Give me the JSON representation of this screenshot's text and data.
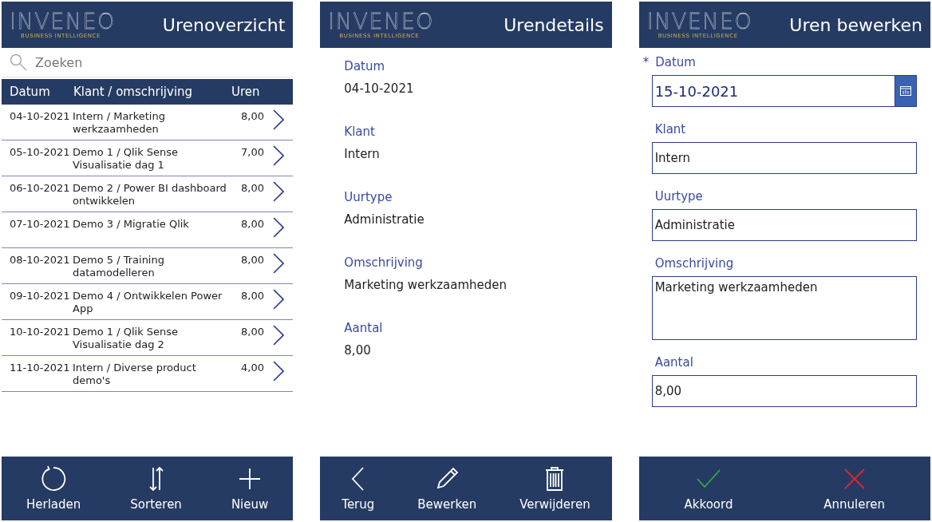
{
  "screens": [
    {
      "kind": "list",
      "logo": {
        "name": "INVENEO",
        "tagline": "BUSINESS INTELLIGENCE"
      },
      "title": "Urenoverzicht",
      "search": {
        "placeholder": "Zoeken"
      },
      "columns": [
        "Datum",
        "Klant / omschrijving",
        "Uren"
      ],
      "rows": [
        {
          "date": "04-10-2021",
          "description": "Intern / Marketing werkzaamheden",
          "hours": "8,00"
        },
        {
          "date": "05-10-2021",
          "description": "Demo 1 / Qlik Sense Visualisatie dag 1",
          "hours": "7,00"
        },
        {
          "date": "06-10-2021",
          "description": "Demo 2 / Power BI dashboard ontwikkelen",
          "hours": "8,00"
        },
        {
          "date": "07-10-2021",
          "description": "Demo 3 / Migratie Qlik",
          "hours": "8,00"
        },
        {
          "date": "08-10-2021",
          "description": "Demo 5 / Training datamodelleren",
          "hours": "8,00"
        },
        {
          "date": "09-10-2021",
          "description": "Demo 4 / Ontwikkelen Power App",
          "hours": "8,00"
        },
        {
          "date": "10-10-2021",
          "description": "Demo 1 / Qlik Sense Visualisatie dag 2",
          "hours": "8,00"
        },
        {
          "date": "11-10-2021",
          "description": "Intern / Diverse product demo's",
          "hours": "4,00"
        }
      ],
      "toolbar": [
        {
          "label": "Herladen",
          "kind": "refresh"
        },
        {
          "label": "Sorteren",
          "kind": "sort"
        },
        {
          "label": "Nieuw",
          "kind": "plus"
        }
      ]
    },
    {
      "kind": "details",
      "logo": {
        "name": "INVENEO",
        "tagline": "BUSINESS INTELLIGENCE"
      },
      "title": "Urendetails",
      "fields": [
        {
          "label": "Datum",
          "value": "04-10-2021"
        },
        {
          "label": "Klant",
          "value": "Intern"
        },
        {
          "label": "Uurtype",
          "value": "Administratie"
        },
        {
          "label": "Omschrijving",
          "value": "Marketing werkzaamheden"
        },
        {
          "label": "Aantal",
          "value": "8,00"
        }
      ],
      "toolbar": [
        {
          "label": "Terug",
          "kind": "back"
        },
        {
          "label": "Bewerken",
          "kind": "pencil"
        },
        {
          "label": "Verwijderen",
          "kind": "trash"
        }
      ]
    },
    {
      "kind": "form",
      "logo": {
        "name": "INVENEO",
        "tagline": "BUSINESS INTELLIGENCE"
      },
      "title": "Uren bewerken",
      "fields": [
        {
          "kind": "date",
          "marker": "*",
          "label": "Datum",
          "value": "15-10-2021"
        },
        {
          "kind": "text",
          "label": "Klant",
          "value": "Intern"
        },
        {
          "kind": "text",
          "label": "Uurtype",
          "value": "Administratie"
        },
        {
          "kind": "multiline",
          "label": "Omschrijving",
          "value": "Marketing werkzaamheden"
        },
        {
          "kind": "text",
          "label": "Aantal",
          "value": "8,00"
        }
      ],
      "toolbar": [
        {
          "label": "Akkoord",
          "kind": "check"
        },
        {
          "label": "Annuleren",
          "kind": "cross"
        }
      ]
    }
  ]
}
